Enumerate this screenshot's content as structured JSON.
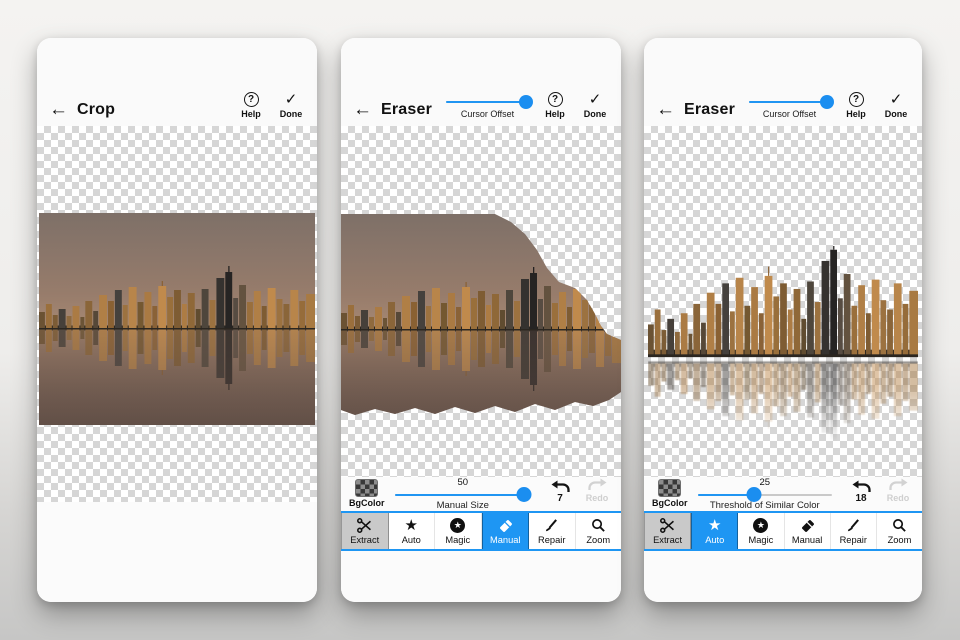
{
  "glyphs": {
    "back": "←",
    "check": "✓",
    "question": "?",
    "star": "★"
  },
  "colors": {
    "accent": "#1e96f3",
    "tab_selected": "#1e96f3",
    "extract_bg": "#c9c9c9"
  },
  "tabs": [
    {
      "label": "Extract",
      "icon": "scissors-icon"
    },
    {
      "label": "Auto",
      "icon": "star-icon"
    },
    {
      "label": "Magic",
      "icon": "magic-star-icon"
    },
    {
      "label": "Manual",
      "icon": "eraser-icon"
    },
    {
      "label": "Repair",
      "icon": "repair-brush-icon"
    },
    {
      "label": "Zoom",
      "icon": "magnifier-icon"
    }
  ],
  "panel1": {
    "title": "Crop",
    "help_label": "Help",
    "done_label": "Done"
  },
  "panel2": {
    "title": "Eraser",
    "cursor_offset_label": "Cursor Offset",
    "help_label": "Help",
    "done_label": "Done",
    "bgcolor_label": "BgColor",
    "slider_value": "50",
    "slider_label": "Manual Size",
    "undo_count": "7",
    "redo_label": "Redo",
    "active_tab": "Manual"
  },
  "panel3": {
    "title": "Eraser",
    "cursor_offset_label": "Cursor Offset",
    "help_label": "Help",
    "done_label": "Done",
    "bgcolor_label": "BgColor",
    "slider_value": "25",
    "slider_label": "Threshold of Similar Color",
    "undo_count": "18",
    "redo_label": "Redo",
    "active_tab": "Auto"
  }
}
